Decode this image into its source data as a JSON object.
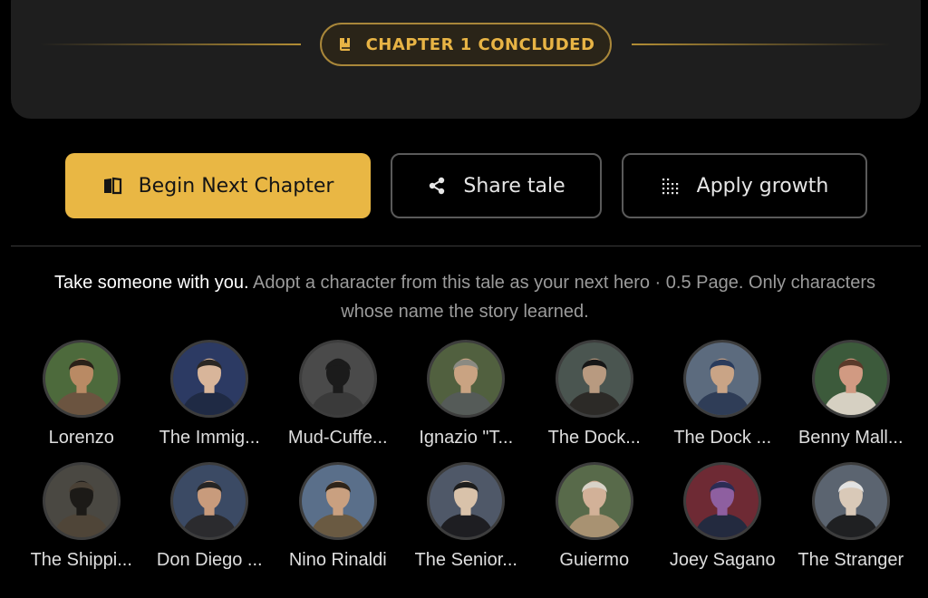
{
  "chapter": {
    "status_label": "CHAPTER 1 CONCLUDED",
    "icon": "book-icon",
    "accent": "#e8b445"
  },
  "actions": {
    "next_chapter": {
      "label": "Begin Next Chapter",
      "icon": "open-book-icon",
      "bg": "#e9b744"
    },
    "share": {
      "label": "Share tale",
      "icon": "share-icon"
    },
    "growth": {
      "label": "Apply growth",
      "icon": "dots-grid-icon"
    }
  },
  "adopt": {
    "lead": "Take someone with you.",
    "body": " Adopt a character from this tale as your next hero · 0.5 Page. Only characters whose name the story learned."
  },
  "characters": [
    {
      "name": "Lorenzo",
      "bg": "#4d6a3c",
      "skin": "#b98a64",
      "hair": "#2a2118",
      "coat": "#6b5440"
    },
    {
      "name": "The Immig...",
      "bg": "#2c3a63",
      "skin": "#d8b59a",
      "hair": "#2b2723",
      "coat": "#1f2a44"
    },
    {
      "name": "Mud-Cuffe...",
      "bg": "#4a4a4a",
      "skin": "#1b1b1b",
      "hair": "#1b1b1b",
      "coat": "#3a3a3a"
    },
    {
      "name": "Ignazio \"T...",
      "bg": "#51603f",
      "skin": "#c9a382",
      "hair": "#8a8a82",
      "coat": "#555b58"
    },
    {
      "name": "The Dock...",
      "bg": "#4a5550",
      "skin": "#b89a80",
      "hair": "#161616",
      "coat": "#2c2a27"
    },
    {
      "name": "The Dock ...",
      "bg": "#5c6b7e",
      "skin": "#c9a486",
      "hair": "#2a3b5c",
      "coat": "#2f3d57"
    },
    {
      "name": "Benny Mall...",
      "bg": "#3c5a3b",
      "skin": "#d19a82",
      "hair": "#5a3a2a",
      "coat": "#d6d0c2"
    },
    {
      "name": "The Shippi...",
      "bg": "#4a4842",
      "skin": "#1c1a17",
      "hair": "#4a4136",
      "coat": "#4f4538"
    },
    {
      "name": "Don Diego ...",
      "bg": "#3b4a64",
      "skin": "#c89b7c",
      "hair": "#252424",
      "coat": "#2b2b2e"
    },
    {
      "name": "Nino Rinaldi",
      "bg": "#5a6f8a",
      "skin": "#c9a080",
      "hair": "#2f2419",
      "coat": "#6a5a42"
    },
    {
      "name": "The Senior...",
      "bg": "#4f5868",
      "skin": "#d9c2aa",
      "hair": "#1d1d1d",
      "coat": "#1e1e22"
    },
    {
      "name": "Guiermo",
      "bg": "#586a4a",
      "skin": "#d2b198",
      "hair": "#d8d2c7",
      "coat": "#a89272"
    },
    {
      "name": "Joey Sagano",
      "bg": "#6e2a34",
      "skin": "#8e5fa0",
      "hair": "#2c2c54",
      "coat": "#232a3f"
    },
    {
      "name": "The Stranger",
      "bg": "#5b6470",
      "skin": "#d9c9b8",
      "hair": "#e2e2e2",
      "coat": "#1f2022"
    }
  ]
}
